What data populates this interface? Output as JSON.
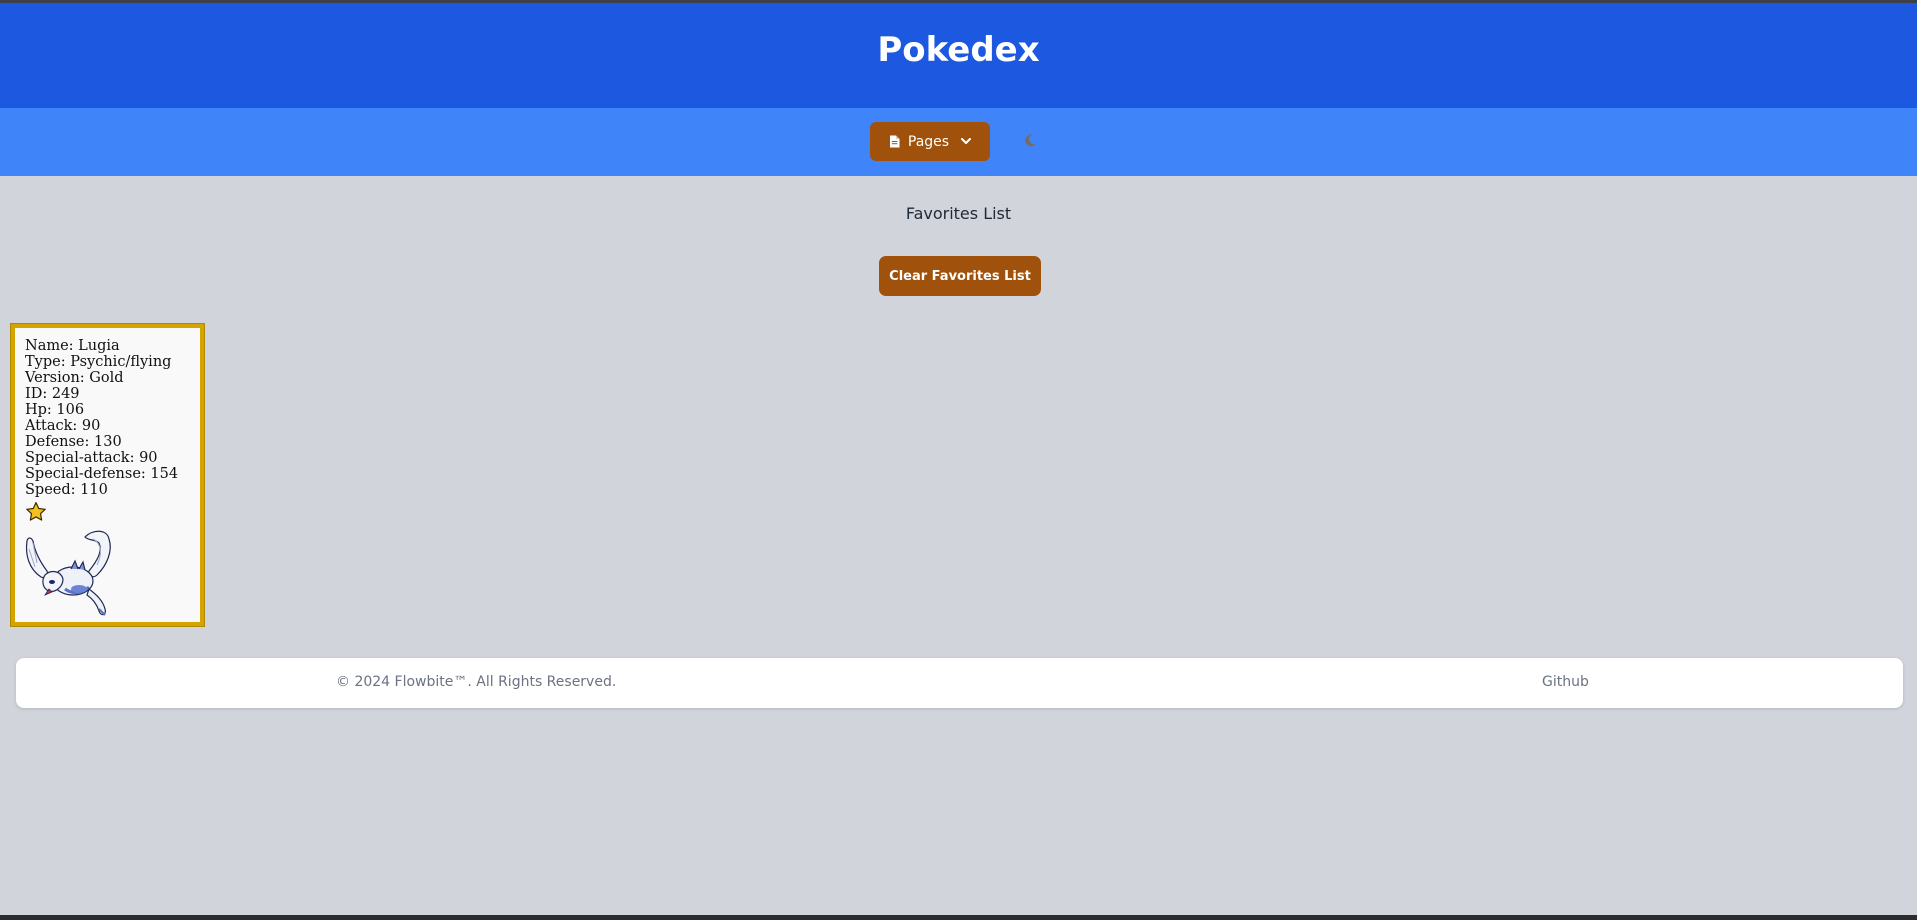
{
  "header": {
    "title": "Pokedex"
  },
  "nav": {
    "pages_label": "Pages",
    "doc_icon": "document-icon",
    "chevron_icon": "chevron-down-icon",
    "theme_icon": "moon-icon"
  },
  "main": {
    "favorites_title": "Favorites List",
    "clear_button_label": "Clear Favorites List"
  },
  "favorites": [
    {
      "lines": [
        "Name: Lugia",
        "Type: Psychic/flying",
        "Version: Gold",
        "ID: 249",
        "Hp: 106",
        "Attack: 90",
        "Defense: 130",
        "Special-attack: 90",
        "Special-defense: 154",
        "Speed: 110"
      ],
      "favorite_icon": "star-icon"
    }
  ],
  "footer": {
    "copyright": "© 2024 Flowbite™. All Rights Reserved.",
    "github_link": "Github"
  },
  "colors": {
    "header_bg": "#1d58e0",
    "navbar_bg": "#3f84f8",
    "button_bg": "#a0520c",
    "page_bg": "#d1d5db",
    "card_border": "#d4a500"
  }
}
